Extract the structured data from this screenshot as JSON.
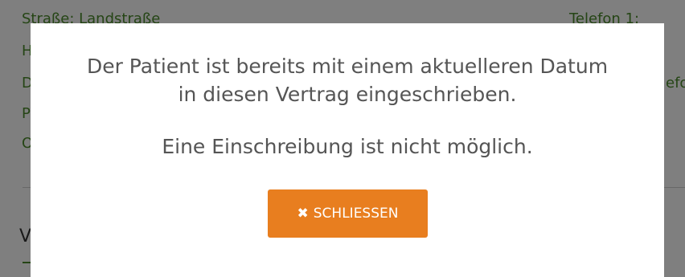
{
  "background": {
    "street_label": "Straße: Landstraße",
    "phone_label": "Telefon 1:",
    "row_letters": [
      "H",
      "D",
      "P",
      "O"
    ],
    "right_fragment": "efo",
    "section_letter": "V"
  },
  "modal": {
    "message_line1": "Der Patient ist bereits mit einem aktuelleren Datum",
    "message_line2": "in diesen Vertrag eingeschrieben.",
    "submessage": "Eine Einschreibung ist nicht möglich.",
    "close_label": "SCHLIESSEN",
    "close_icon": "close-icon"
  },
  "colors": {
    "accent_button": "#e87e1f",
    "background_text": "#4a8a2a",
    "message_text": "#555555"
  }
}
